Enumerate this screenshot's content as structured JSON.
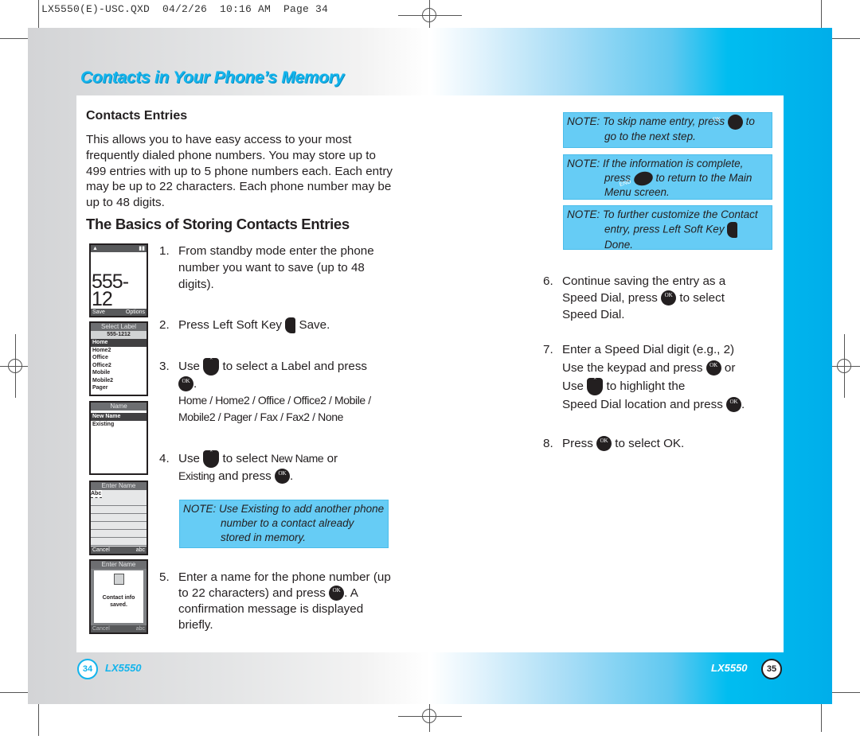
{
  "slug": "LX5550(E)-USC.QXD  04/2/26  10:16 AM  Page 34",
  "header": {
    "title": "Contacts in Your Phone’s Memory"
  },
  "left_page": {
    "section_heading": "Contacts Entries",
    "intro": "This allows you to have easy access to your most frequently dialed phone numbers. You may store up to 499 entries with up to 5 phone numbers each. Each entry may be up to 22 characters. Each phone number may be up to 48 digits.",
    "subheading": "The Basics of Storing Contacts Entries",
    "steps": [
      {
        "num": "1.",
        "text": "From standby mode enter the phone number you want to save (up to 48 digits)."
      },
      {
        "num": "2.",
        "pre": "Press Left Soft Key",
        "post": "Save."
      },
      {
        "num": "3.",
        "pre": "Use",
        "mid": "to select a Label and press",
        "post": ".",
        "labels": "Home / Home2 / Office / Office2 / Mobile / Mobile2 / Pager / Fax / Fax2 / None"
      },
      {
        "num": "4.",
        "pre": "Use",
        "mid": "to select",
        "opt1": "New Name",
        "or": "or",
        "opt2": "Existing",
        "mid2": "and press",
        "post": "."
      },
      {
        "num": "5.",
        "pre": "Enter a name for the phone number (up to 22 characters) and press",
        "post": ". A confirmation message is displayed briefly."
      }
    ],
    "note": {
      "label": "NOTE:",
      "text": "Use Existing to add another phone number to a contact already stored in memory."
    },
    "footer": {
      "page_number": "34",
      "model": "LX5550"
    }
  },
  "phone_screens": [
    {
      "name": "dial-screen",
      "number_line1": "555-12",
      "number_line2": "12",
      "left_soft": "Save",
      "right_soft": "Options"
    },
    {
      "name": "select-label-screen",
      "title": "Select Label",
      "number": "555-1212",
      "items": [
        "Home",
        "Home2",
        "Office",
        "Office2",
        "Mobile",
        "Mobile2",
        "Pager"
      ],
      "selected": "Home"
    },
    {
      "name": "name-screen",
      "title": "Name",
      "items": [
        "New Name",
        "Existing"
      ],
      "selected": "New Name"
    },
    {
      "name": "enter-name-screen",
      "title": "Enter Name",
      "input": "Abc",
      "left_soft": "Cancel",
      "right_soft": "abc"
    },
    {
      "name": "saved-screen",
      "title": "Enter Name",
      "message_line1": "Contact info",
      "message_line2": "saved.",
      "left_soft": "Cancel",
      "right_soft": "abc"
    }
  ],
  "right_page": {
    "notes": [
      {
        "label": "NOTE:",
        "pre": "To skip name entry, press",
        "post": "to go to the next step."
      },
      {
        "label": "NOTE:",
        "pre": "If the information is complete, press",
        "post": "to return to the Main Menu screen."
      },
      {
        "label": "NOTE:",
        "pre": "To further customize the Contact entry, press Left Soft Key",
        "post": "Done."
      }
    ],
    "steps": [
      {
        "num": "6.",
        "pre": "Continue saving the entry as a Speed Dial, press",
        "post": "to select Speed Dial."
      },
      {
        "num": "7.",
        "line1": "Enter a Speed Dial digit (e.g., 2)",
        "pre": "Use the keypad and press",
        "or": "or",
        "use": "Use",
        "mid": "to highlight the",
        "last": "Speed Dial location and press",
        "post": "."
      },
      {
        "num": "8.",
        "pre": "Press",
        "post": "to select OK."
      }
    ],
    "footer": {
      "page_number": "35",
      "model": "LX5550"
    }
  },
  "keys": {
    "ok_top": "OK",
    "ok_bottom": "⊙",
    "end": "END"
  },
  "colors": {
    "accent": "#13b4ec",
    "note_bg": "#66ccf5",
    "band_blue": "#00aeea"
  }
}
